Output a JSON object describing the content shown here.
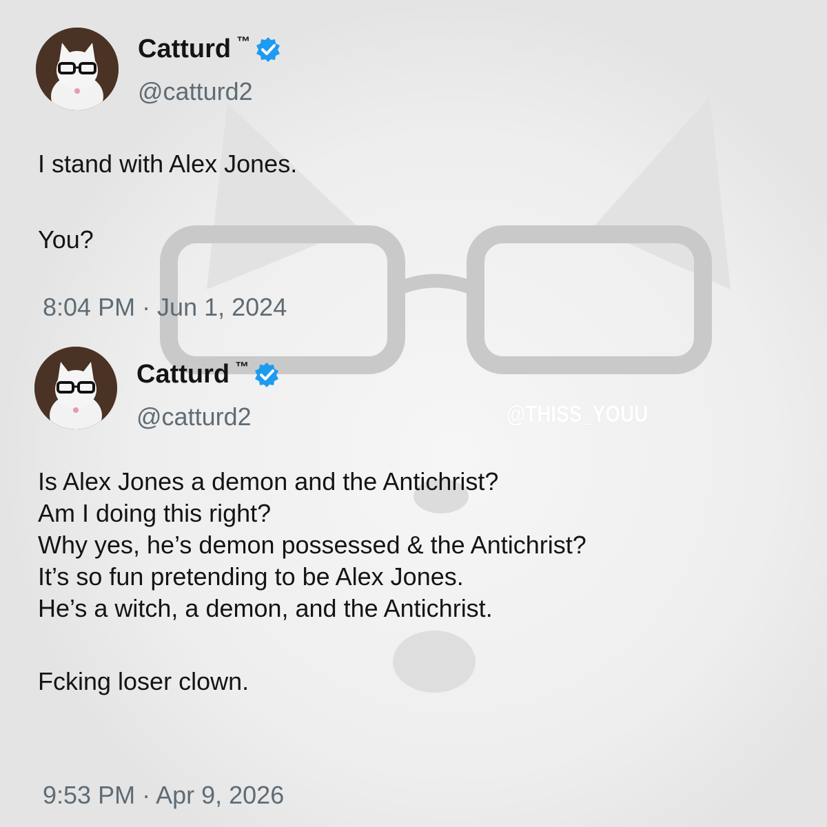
{
  "tweets": [
    {
      "name": "Catturd",
      "tm": "™",
      "handle": "@catturd2",
      "lines": [
        "I stand with Alex Jones.",
        "",
        "You?"
      ],
      "timestamp": "8:04 PM · Jun 1, 2024"
    },
    {
      "name": "Catturd",
      "tm": "™",
      "handle": "@catturd2",
      "lines": [
        "Is Alex Jones a demon and the Antichrist?",
        "Am I doing this right?",
        "Why yes, he’s demon possessed & the Antichrist?",
        "It’s so fun pretending to be Alex Jones.",
        "He’s a witch, a demon, and the Antichrist.",
        "",
        "Fcking loser clown."
      ],
      "timestamp": "9:53 PM · Apr 9, 2026"
    }
  ],
  "watermark": "@THISS_YOUU",
  "colors": {
    "badge": "#1d9bf0",
    "text": "#141414",
    "muted": "#5f6b74"
  }
}
